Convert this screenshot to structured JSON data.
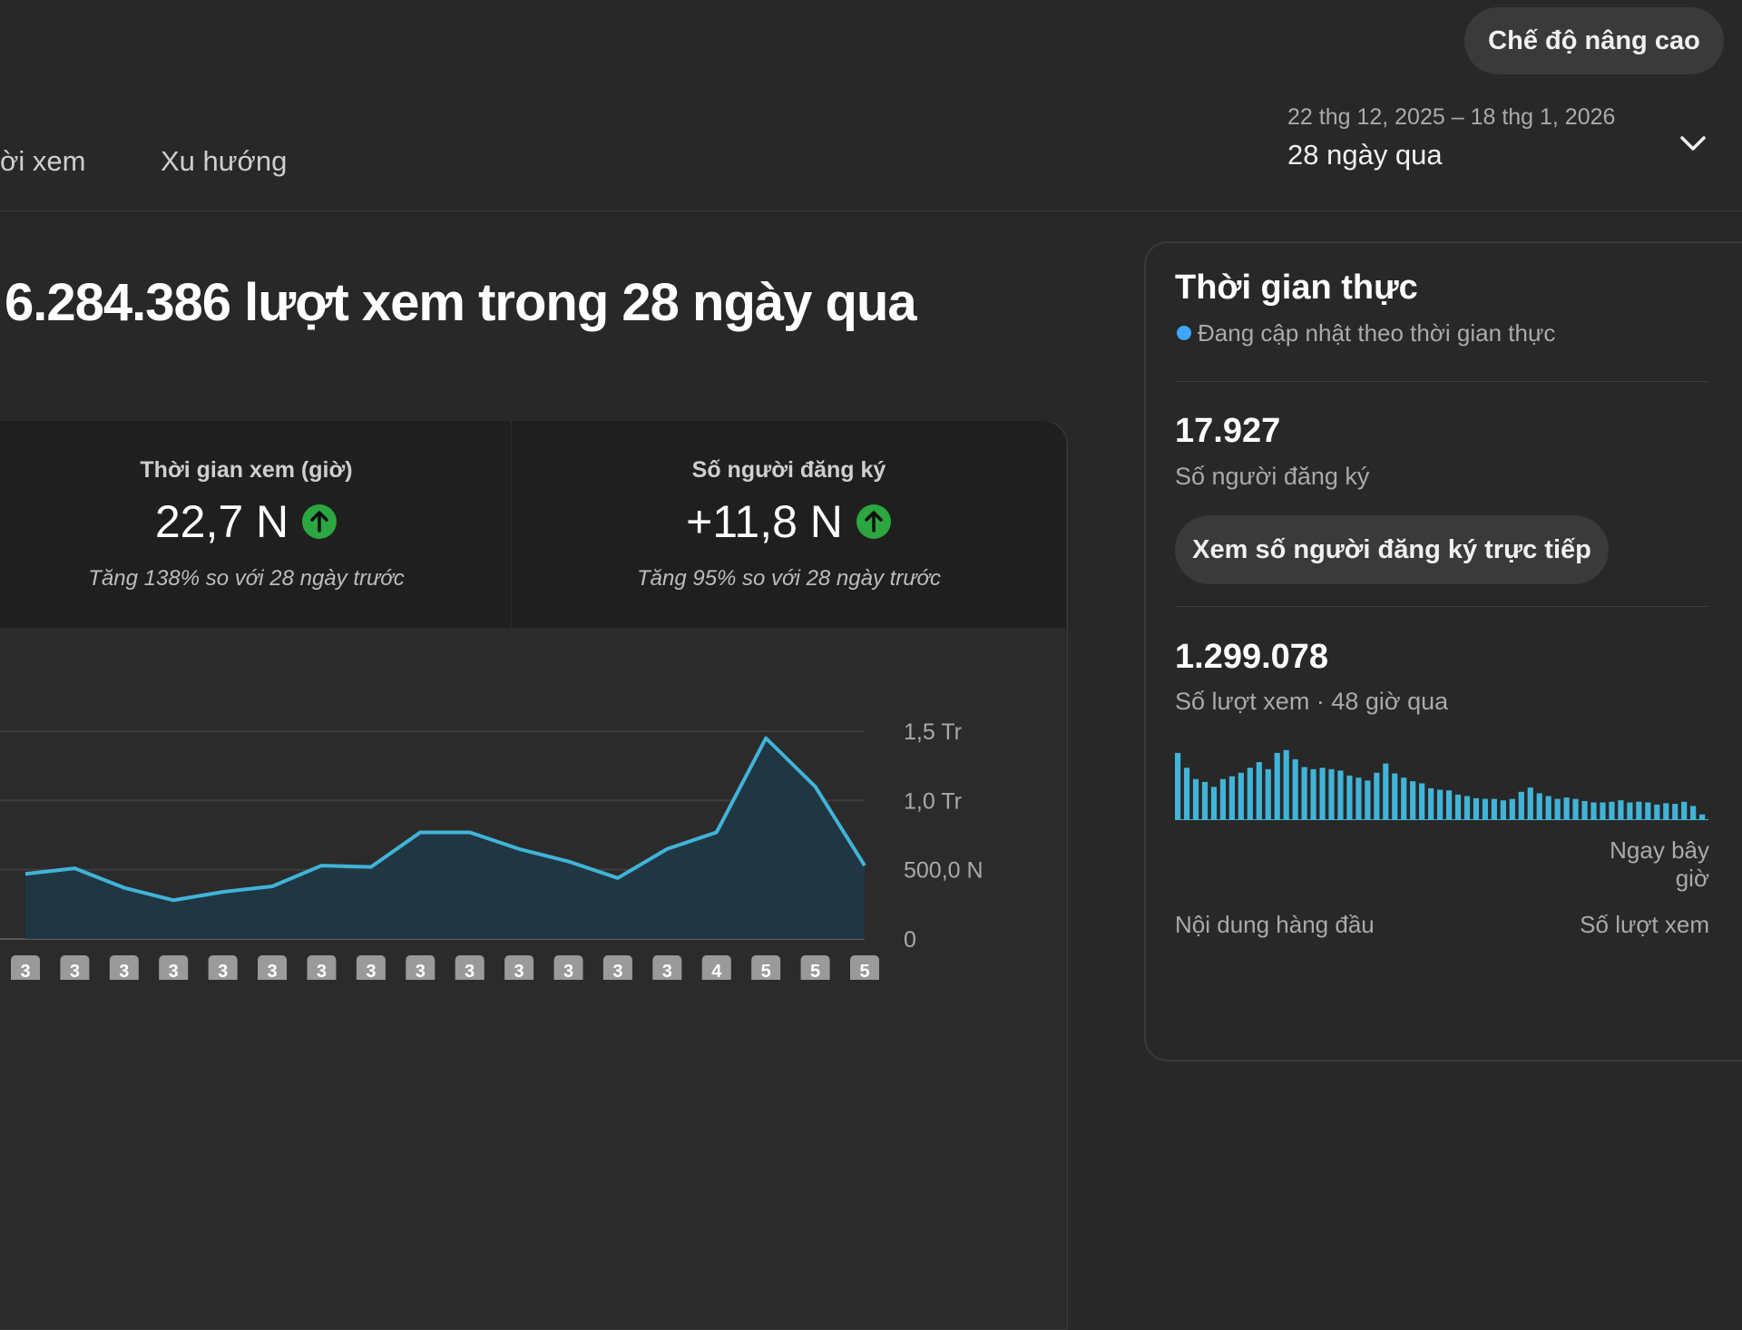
{
  "header": {
    "advanced_mode_label": "Chế độ nâng cao",
    "tabs": [
      {
        "label": "ời xem"
      },
      {
        "label": "Xu hướng"
      }
    ],
    "date_range": "22 thg 12, 2025 – 18 thg 1, 2026",
    "date_preset": "28 ngày qua",
    "dropdown_icon": "chevron-down-icon"
  },
  "main": {
    "headline": "6.284.386 lượt xem trong 28 ngày qua",
    "metrics": [
      {
        "label": "Thời gian xem (giờ)",
        "value": "22,7 N",
        "trend_icon": "arrow-up-icon",
        "change": "Tăng 138% so với 28 ngày trước"
      },
      {
        "label": "Số người đăng ký",
        "value": "+11,8 N",
        "trend_icon": "arrow-up-icon",
        "change": "Tăng 95% so với 28 ngày trước"
      }
    ]
  },
  "chart_data": {
    "type": "area",
    "y_tick_labels": [
      "1,5 Tr",
      "1,0 Tr",
      "500,0 N",
      "0"
    ],
    "ylim": [
      0,
      1500000
    ],
    "values": [
      470000,
      510000,
      370000,
      280000,
      340000,
      380000,
      530000,
      520000,
      770000,
      770000,
      650000,
      560000,
      440000,
      650000,
      770000,
      1450000,
      1100000,
      530000
    ],
    "x_markers": [
      "3",
      "3",
      "3",
      "3",
      "3",
      "3",
      "3",
      "3",
      "3",
      "3",
      "3",
      "3",
      "3",
      "3",
      "4",
      "5",
      "5",
      "5"
    ],
    "grid": true,
    "color": "#41b4d8"
  },
  "realtime": {
    "title": "Thời gian thực",
    "status": "Đang cập nhật theo thời gian thực",
    "status_color": "#3ea6ff",
    "subscribers_value": "17.927",
    "subscribers_label": "Số người đăng ký",
    "live_subs_button": "Xem số người đăng ký trực tiếp",
    "views_value": "1.299.078",
    "views_label": "Số lượt xem · 48 giờ qua",
    "views_bars": [
      0.95,
      0.74,
      0.58,
      0.54,
      0.47,
      0.58,
      0.62,
      0.67,
      0.74,
      0.82,
      0.72,
      0.95,
      0.99,
      0.86,
      0.75,
      0.72,
      0.74,
      0.72,
      0.7,
      0.63,
      0.6,
      0.56,
      0.67,
      0.8,
      0.66,
      0.6,
      0.55,
      0.52,
      0.45,
      0.43,
      0.42,
      0.36,
      0.34,
      0.31,
      0.3,
      0.3,
      0.28,
      0.3,
      0.4,
      0.46,
      0.38,
      0.34,
      0.3,
      0.32,
      0.3,
      0.27,
      0.25,
      0.25,
      0.26,
      0.28,
      0.25,
      0.26,
      0.25,
      0.22,
      0.24,
      0.23,
      0.26,
      0.2,
      0.08
    ],
    "bar_color": "#41b4d8",
    "now_label": "Ngay bây giờ",
    "top_content_label": "Nội dung hàng đầu",
    "top_content_views_label": "Số lượt xem"
  }
}
